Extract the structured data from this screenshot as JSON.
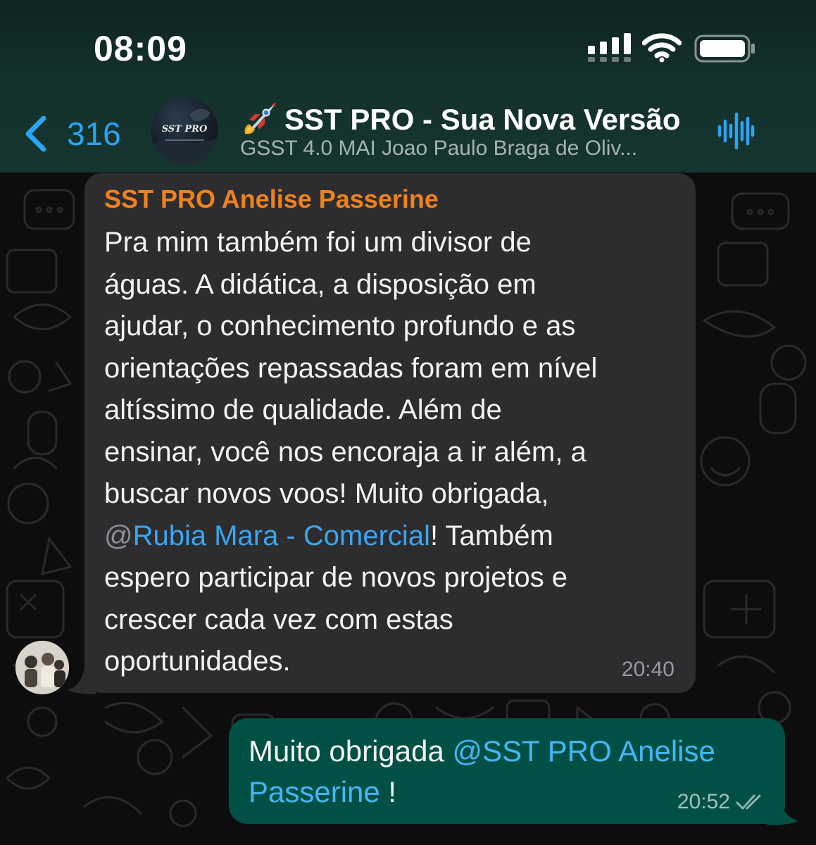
{
  "status_bar": {
    "time": "08:09"
  },
  "header": {
    "back_count": "316",
    "avatar_text": "SST PRO",
    "title": "SST PRO - Sua Nova Versão",
    "title_emoji": "rocket-icon",
    "subtitle": "GSST 4.0 MAI Joao Paulo Braga de Oliv..."
  },
  "messages": [
    {
      "direction": "incoming",
      "sender": "SST PRO Anelise Passerine",
      "lines": {
        "l1": "Pra mim também foi um divisor de",
        "l2": "águas. A didática, a disposição em",
        "l3": "ajudar, o conhecimento profundo e as",
        "l4": "orientações repassadas foram em nível",
        "l5": "altíssimo de qualidade.  Além de",
        "l6": "ensinar, você nos encoraja a ir além, a",
        "l7": "buscar novos voos! Muito obrigada,",
        "l8_at": "@",
        "l8_mention": "Rubia Mara - Comercial",
        "l8_rest": "! Também",
        "l9": "espero participar de novos projetos e",
        "l10": "crescer cada vez com estas",
        "l11": "oportunidades."
      },
      "time": "20:40"
    },
    {
      "direction": "outgoing",
      "text_before": "Muito obrigada ",
      "mention_part1": "@SST PRO Anelise",
      "mention_part2": "Passerine",
      "text_after": " !",
      "time": "20:52",
      "status": "read"
    }
  ],
  "colors": {
    "accent_blue": "#2aa4f4",
    "sender_name": "#f0821e",
    "incoming_bubble": "#2d2d2f",
    "outgoing_bubble": "#005046"
  }
}
